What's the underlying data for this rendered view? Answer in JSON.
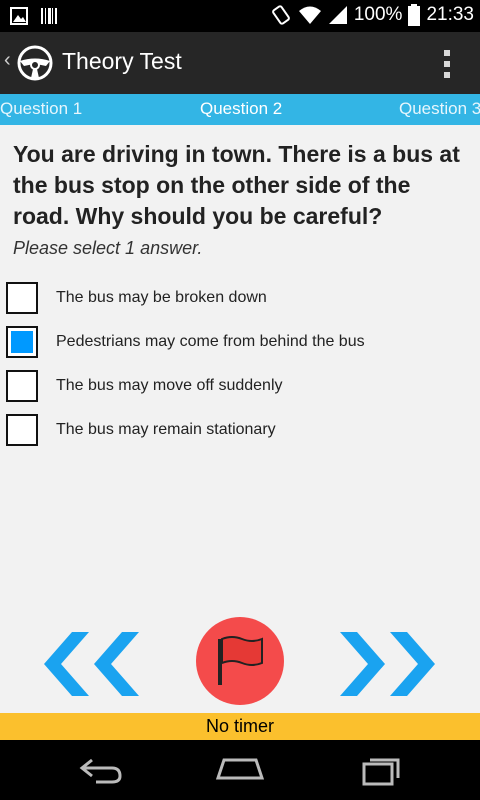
{
  "status_bar": {
    "battery_percent": "100%",
    "time": "21:33",
    "icons": [
      "image-notification-icon",
      "barcode-notification-icon",
      "rotate-icon",
      "wifi-icon",
      "signal-icon",
      "battery-icon"
    ]
  },
  "action_bar": {
    "title": "Theory Test",
    "icons": [
      "up-arrow-icon",
      "steering-wheel-icon",
      "overflow-menu-icon"
    ]
  },
  "tabs": [
    {
      "label": "Question 1"
    },
    {
      "label": "Question 2"
    },
    {
      "label": "Question 3"
    }
  ],
  "question": {
    "text": "You are driving in town. There is a bus at the bus stop on the other side of the road. Why should you be careful?",
    "instruction": "Please select 1 answer."
  },
  "answers": [
    {
      "label": "The bus may be broken down",
      "selected": false
    },
    {
      "label": "Pedestrians may come from behind the bus",
      "selected": true
    },
    {
      "label": "The bus may move off suddenly",
      "selected": false
    },
    {
      "label": "The bus may remain stationary",
      "selected": false
    }
  ],
  "controls": {
    "prev_icon": "double-chevron-left-icon",
    "flag_icon": "flag-icon",
    "next_icon": "double-chevron-right-icon"
  },
  "timer": {
    "label": "No timer"
  },
  "colors": {
    "accent": "#33b5e5",
    "selected": "#0099ff",
    "flag": "#f44b4b",
    "timer": "#fbc02d",
    "arrows": "#1aa3f0"
  }
}
